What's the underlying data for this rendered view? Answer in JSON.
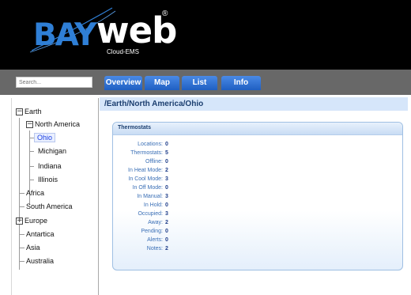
{
  "logo": {
    "bay": "BAY",
    "web": "web",
    "reg": "®",
    "sub": "Cloud-EMS"
  },
  "search": {
    "placeholder": "Search..."
  },
  "tabs": [
    {
      "label": "Overview"
    },
    {
      "label": "Map"
    },
    {
      "label": "List"
    },
    {
      "label": "Info"
    }
  ],
  "tree": {
    "earth": "Earth",
    "north_america": "North America",
    "ohio": "Ohio",
    "michigan": "Michigan",
    "indiana": "Indiana",
    "illinois": "Illinois",
    "africa": "Africa",
    "south_america": "South America",
    "europe": "Europe",
    "antartica": "Antartica",
    "asia": "Asia",
    "australia": "Australia",
    "expanded_glyph": "−",
    "collapsed_glyph": "+"
  },
  "breadcrumb": "/Earth/North America/Ohio",
  "thermostats": {
    "title": "Thermostats",
    "rows": [
      {
        "label": "Locations:",
        "value": "0"
      },
      {
        "label": "Thermostats:",
        "value": "5"
      },
      {
        "label": "Offline:",
        "value": "0"
      },
      {
        "label": "In Heat Mode:",
        "value": "2"
      },
      {
        "label": "In Cool Mode:",
        "value": "3"
      },
      {
        "label": "In Off Mode:",
        "value": "0"
      },
      {
        "label": "In Manual:",
        "value": "3"
      },
      {
        "label": "In Hold:",
        "value": "0"
      },
      {
        "label": "Occupied:",
        "value": "3"
      },
      {
        "label": "Away:",
        "value": "2"
      },
      {
        "label": "Pending:",
        "value": "0"
      },
      {
        "label": "Alerts:",
        "value": "0"
      },
      {
        "label": "Notes:",
        "value": "2"
      }
    ]
  },
  "colors": {
    "header_bg": "#000000",
    "topbar_bg": "#686868",
    "tab_blue": "#2f6fd6",
    "brand_blue": "#2f7fd6",
    "selected_link": "#1c3fe3",
    "path_bar_bg": "#d6e6fa"
  }
}
